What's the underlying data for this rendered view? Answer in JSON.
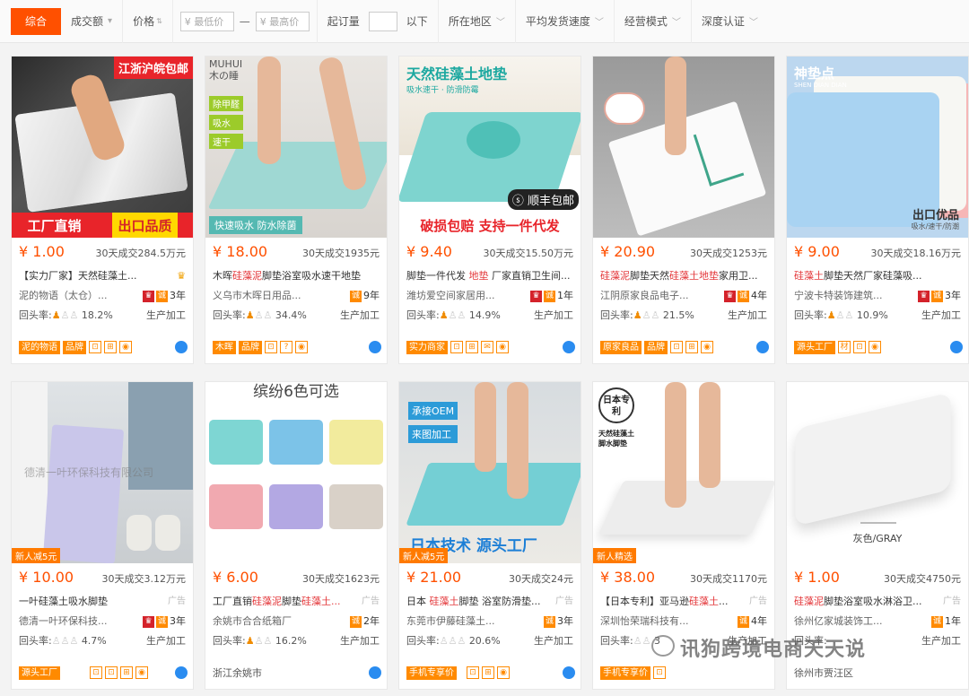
{
  "filters": {
    "sort_default": "综合",
    "sales": "成交额",
    "price": "价格",
    "price_min_placeholder": "¥ 最低价",
    "price_dash": "—",
    "price_max_placeholder": "¥ 最高价",
    "min_order": "起订量",
    "below": "以下",
    "location": "所在地区",
    "delivery": "平均发货速度",
    "mode": "经营模式",
    "cert": "深度认证"
  },
  "cards": [
    {
      "price": "¥ 1.00",
      "sold": "30天成交284.5万元",
      "title": "【实力厂家】天然硅藻土...",
      "seller": "泥的物语（太仓）...",
      "years": "3年",
      "repeat_label": "回头率:",
      "repeat": "18.2%",
      "mode": "生产加工",
      "img_top": "江浙沪皖包邮",
      "img_bottom_a": "工厂直销",
      "img_bottom_b": "出口品质",
      "tags": [
        "泥的物语",
        "品牌"
      ]
    },
    {
      "price": "¥ 18.00",
      "sold": "30天成交1935元",
      "title_a": "木晖",
      "title_hl": "硅藻泥",
      "title_b": "脚垫浴室吸水速干地垫",
      "seller": "义乌市木晖日用品...",
      "years": "9年",
      "repeat_label": "回头率:",
      "repeat": "34.4%",
      "mode": "生产加工",
      "img_brand": "MUHUI 木の睡",
      "img_labels": [
        "除甲醛",
        "吸水",
        "速干"
      ],
      "img_bottom": "快速吸水 防水除菌",
      "tags": [
        "木晖",
        "品牌"
      ]
    },
    {
      "price": "¥ 9.40",
      "sold": "30天成交15.50万元",
      "title_a": "脚垫一件代发 ",
      "title_hl": "地垫",
      "title_b": " 厂家直销卫生间...",
      "seller": "潍坊爱空间家居用...",
      "years": "1年",
      "repeat_label": "回头率:",
      "repeat": "14.9%",
      "mode": "生产加工",
      "img_title": "天然硅藻土地垫",
      "img_sub": "吸水速干 · 防滑防霉",
      "img_sf": "顺丰包邮",
      "img_bottom": "破损包赔 支持一件代发",
      "tags": [
        "实力商家"
      ]
    },
    {
      "price": "¥ 20.90",
      "sold": "30天成交1253元",
      "title_hl": "硅藻泥",
      "title_a": "脚垫天然",
      "title_hl2": "硅藻土地垫",
      "title_b": "家用卫...",
      "seller": "江阴原家良品电子...",
      "years": "4年",
      "repeat_label": "回头率:",
      "repeat": "21.5%",
      "mode": "生产加工",
      "tags": [
        "原家良品",
        "品牌"
      ]
    },
    {
      "price": "¥ 9.00",
      "sold": "30天成交18.16万元",
      "title_hl": "硅藻土",
      "title_a": "脚垫天然厂家硅藻吸...",
      "seller": "宁波卡特装饰建筑...",
      "years": "3年",
      "repeat_label": "回头率:",
      "repeat": "10.9%",
      "mode": "生产加工",
      "img_brand": "神垫点",
      "img_brand_sub": "SHEN DIAN DIAN",
      "img_bottom": "出口优品",
      "img_bottom_sub": "吸水/速干/防潮",
      "tags": [
        "源头工厂"
      ]
    },
    {
      "price": "¥ 10.00",
      "sold": "30天成交3.12万元",
      "title": "一叶硅藻土吸水脚垫",
      "seller": "德清一叶环保科技...",
      "years": "3年",
      "repeat_label": "回头率:",
      "repeat": "4.7%",
      "mode": "生产加工",
      "img_watermark": "德清一叶环保科技有限公司",
      "ribbon": "新人减5元",
      "tags": [
        "源头工厂"
      ]
    },
    {
      "price": "¥ 6.00",
      "sold": "30天成交1623元",
      "title_a": "工厂直销",
      "title_hl": "硅藻泥",
      "title_b": "脚垫",
      "title_hl2": "硅藻土...",
      "seller": "余姚市合合纸箱厂",
      "years": "2年",
      "repeat_label": "回头率:",
      "repeat": "16.2%",
      "mode": "生产加工",
      "img_title": "缤纷6色可选",
      "swatches": [
        "#7ed6d3",
        "#7cc3e8",
        "#f2eb9d",
        "#f1a9b0",
        "#b3a8e3",
        "#d9d1c8"
      ],
      "location": "浙江余姚市"
    },
    {
      "price": "¥ 21.00",
      "sold": "30天成交24元",
      "title_a": "日本 ",
      "title_hl": "硅藻土",
      "title_b": "脚垫 浴室防滑垫...",
      "seller": "东莞市伊藤硅藻土...",
      "years": "3年",
      "repeat_label": "回头率:",
      "repeat": "20.6%",
      "mode": "生产加工",
      "img_labels": [
        "承接OEM",
        "来图加工"
      ],
      "img_bottom": "日本技术 源头工厂",
      "ribbon": "新人减5元",
      "tags": [
        "手机专享价"
      ]
    },
    {
      "price": "¥ 38.00",
      "sold": "30天成交1170元",
      "title_a": "【日本专利】亚马逊",
      "title_hl": "硅藻土",
      "title_b": "...",
      "seller": "深圳怡荣瑞科技有...",
      "years": "4年",
      "repeat_label": "回头率:",
      "repeat": "3",
      "mode": "生产加工",
      "img_stamp": "日本专利",
      "img_label": "天然硅藻土 脚水脚垫",
      "ribbon": "新人精选",
      "tags": [
        "手机专享价"
      ]
    },
    {
      "price": "¥ 1.00",
      "sold": "30天成交4750元",
      "title_hl": "硅藻泥",
      "title_a": "脚垫浴室吸水淋浴卫...",
      "seller": "徐州亿家城装饰工...",
      "years": "1年",
      "repeat_label": "回头率:",
      "repeat": "",
      "mode": "生产加工",
      "img_caption": "灰色/GRAY",
      "location": "徐州市贾汪区"
    }
  ],
  "ad_label": "广告",
  "watermark": "讯狗跨境电商天天说"
}
